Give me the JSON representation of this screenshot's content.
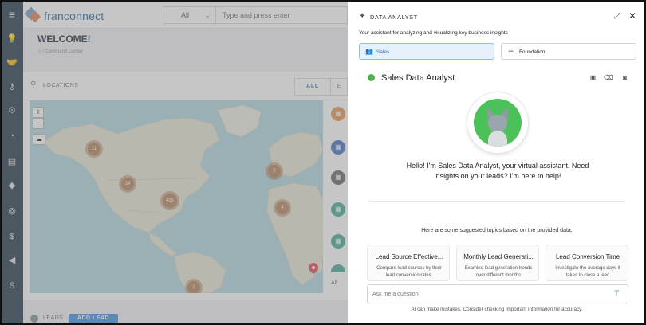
{
  "colors": {
    "nav_bg": "#2f4052",
    "brand_blue": "#2d6da3",
    "accent_blue": "#3b7bd1",
    "cluster_brown": "#b88a63",
    "map_water": "#b6dae0",
    "map_land": "#e9e7d8",
    "selected_bg": "#e6f1fc",
    "agent_green": "#4bb24b"
  },
  "leftnav": {
    "menu_icon": "hamburger-icon",
    "items": [
      {
        "icon": "lightbulb-icon",
        "glyph": "💡"
      },
      {
        "icon": "handshake-icon",
        "glyph": "🤝"
      },
      {
        "icon": "key-icon",
        "glyph": "⚷"
      },
      {
        "icon": "gear-icon",
        "glyph": "⚙"
      },
      {
        "icon": "gauge-icon",
        "glyph": "◔"
      },
      {
        "icon": "chat-icon",
        "glyph": "▤"
      },
      {
        "icon": "megaphone-icon",
        "glyph": "◆"
      },
      {
        "icon": "lifebuoy-icon",
        "glyph": "◎"
      },
      {
        "icon": "money-bag-icon",
        "glyph": "$"
      },
      {
        "icon": "bullhorn-icon",
        "glyph": "◀"
      },
      {
        "icon": "s-icon",
        "glyph": "S"
      }
    ]
  },
  "header": {
    "logo_text": "franconnect",
    "search_scope": "All",
    "search_placeholder": "Type and press enter"
  },
  "main": {
    "welcome": "WELCOME!",
    "breadcrumb": "/ Command Center",
    "locations": {
      "title": "LOCATIONS",
      "tab_all": "ALL",
      "tab_next": "E"
    },
    "map": {
      "zoom_in": "+",
      "zoom_out": "−",
      "clusters": [
        "11",
        "34",
        "405",
        "2",
        "4",
        "2"
      ]
    },
    "side_all": "All",
    "leads": {
      "title": "LEADS",
      "add_button": "ADD LEAD"
    }
  },
  "panel": {
    "title": "DATA ANALYST",
    "subtitle": "Your assistant for analyzing and visualizing key business insights",
    "datasets": [
      {
        "label": "Sales",
        "icon": "people-icon",
        "selected": true
      },
      {
        "label": "Foundation",
        "icon": "database-icon",
        "selected": false
      }
    ],
    "agent_name": "Sales Data Analyst",
    "greeting": "Hello! I'm Sales Data Analyst, your virtual assistant. Need insights on your leads? I'm here to help!",
    "suggested_label": "Here are some suggested topics based on the provided data.",
    "topics": [
      {
        "title": "Lead Source Effective...",
        "desc": "Compare lead sources by their lead conversion rates."
      },
      {
        "title": "Monthly Lead Generati...",
        "desc": "Examine lead generation trends over different months"
      },
      {
        "title": "Lead Conversion Time",
        "desc": "Investigate the average days it takes to close a lead"
      }
    ],
    "ask_placeholder": "Ask me a question",
    "disclaimer": "AI can make mistakes. Consider checking important information for accuracy."
  }
}
